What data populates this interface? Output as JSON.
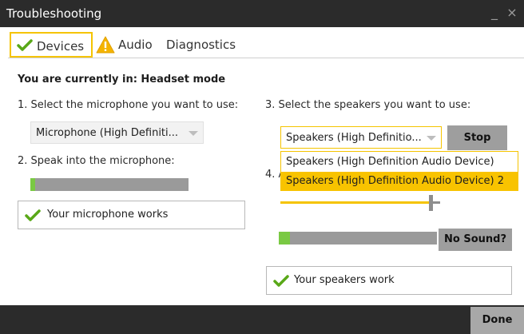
{
  "window": {
    "title": "Troubleshooting",
    "minimize_glyph": "_",
    "close_glyph": "×"
  },
  "tabs": [
    {
      "label": "Devices",
      "icon": "check-icon",
      "active": true
    },
    {
      "label": "Audio",
      "icon": "warning-icon"
    },
    {
      "label": "Diagnostics"
    }
  ],
  "mode_heading": "You are currently in: Headset mode",
  "mic": {
    "step1_label": "1. Select the microphone you want to use:",
    "selected": "Microphone (High Definiti...",
    "step2_label": "2. Speak into the microphone:",
    "level_fraction": 0.03,
    "status": "Your microphone works"
  },
  "speakers": {
    "step3_label": "3. Select the speakers you want to use:",
    "selected": "Speakers (High Definitio...",
    "stop_label": "Stop",
    "options": [
      "Speakers (High Definition Audio Device)",
      "Speakers (High Definition Audio Device) 2"
    ],
    "highlighted_option_index": 1,
    "step4_prefix": "4. A",
    "volume_fraction": 0.93,
    "level_fraction": 0.07,
    "no_sound_label": "No Sound?",
    "status": "Your speakers work"
  },
  "footer": {
    "done_label": "Done"
  },
  "colors": {
    "accent": "#f5c400",
    "ok_green": "#7ac943",
    "titlebar": "#2b2b2b",
    "warning": "#f5b400"
  }
}
